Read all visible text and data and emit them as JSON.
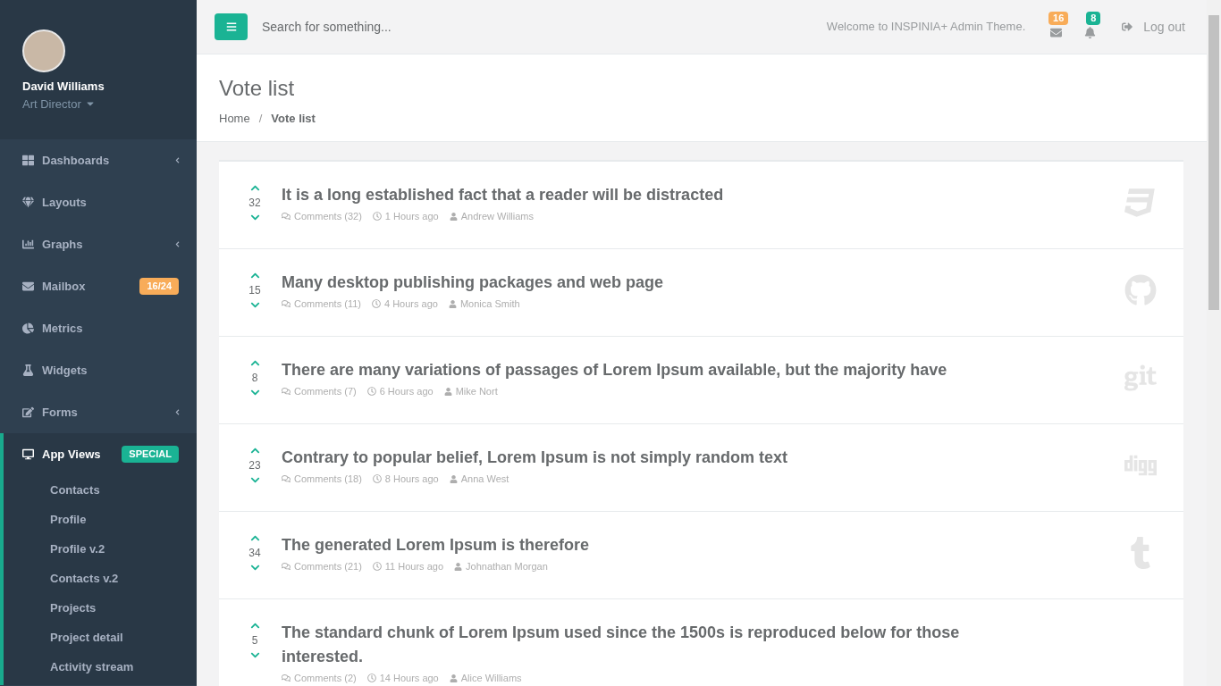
{
  "profile": {
    "name": "David Williams",
    "role": "Art Director"
  },
  "sidebar": {
    "items": [
      {
        "label": "Dashboards",
        "expandable": true,
        "selected": false
      },
      {
        "label": "Layouts",
        "expandable": false,
        "selected": false
      },
      {
        "label": "Graphs",
        "expandable": true,
        "selected": false
      },
      {
        "label": "Mailbox",
        "expandable": false,
        "selected": false,
        "badge": "16/24",
        "color": "#f8ac59"
      },
      {
        "label": "Metrics",
        "expandable": false,
        "selected": false
      },
      {
        "label": "Widgets",
        "expandable": false,
        "selected": false
      },
      {
        "label": "Forms",
        "expandable": true,
        "selected": false
      },
      {
        "label": "App Views",
        "expandable": false,
        "selected": true,
        "badge": "SPECIAL",
        "color": "#1ab394",
        "children": [
          {
            "label": "Contacts"
          },
          {
            "label": "Profile"
          },
          {
            "label": "Profile v.2"
          },
          {
            "label": "Contacts v.2"
          },
          {
            "label": "Projects"
          },
          {
            "label": "Project detail"
          },
          {
            "label": "Activity stream"
          }
        ]
      }
    ]
  },
  "topbar": {
    "search": {
      "placeholder": "Search for something..."
    },
    "welcome": "Welcome to INSPINIA+ Admin Theme.",
    "mail_count": "16",
    "alert_count": "8",
    "logout": "Log out"
  },
  "page": {
    "title": "Vote list",
    "separator": "/",
    "breadcrumb": [
      {
        "label": "Home",
        "selected": false
      },
      {
        "label": "Vote list",
        "selected": true
      }
    ]
  },
  "votes": [
    {
      "score": "32",
      "title": "It is a long established fact that a reader will be distracted",
      "comments": "Comments (32)",
      "time": "1 Hours ago",
      "author": "Andrew Williams",
      "kind": "css3"
    },
    {
      "score": "15",
      "title": "Many desktop publishing packages and web page",
      "comments": "Comments (11)",
      "time": "4 Hours ago",
      "author": "Monica Smith",
      "kind": "github"
    },
    {
      "score": "8",
      "title": "There are many variations of passages of Lorem Ipsum available, but the majority have",
      "comments": "Comments (7)",
      "time": "6 Hours ago",
      "author": "Mike Nort",
      "kind": "git"
    },
    {
      "score": "23",
      "title": "Contrary to popular belief, Lorem Ipsum is not simply random text",
      "comments": "Comments (18)",
      "time": "8 Hours ago",
      "author": "Anna West",
      "kind": "digg"
    },
    {
      "score": "34",
      "title": "The generated Lorem Ipsum is therefore",
      "comments": "Comments (21)",
      "time": "11 Hours ago",
      "author": "Johnathan Morgan",
      "kind": "tumblr"
    },
    {
      "score": "5",
      "title": "The standard chunk of Lorem Ipsum used since the 1500s is reproduced below for those interested.",
      "comments": "Comments (2)",
      "time": "14 Hours ago",
      "author": "Alice Williams",
      "kind": "plain"
    }
  ]
}
